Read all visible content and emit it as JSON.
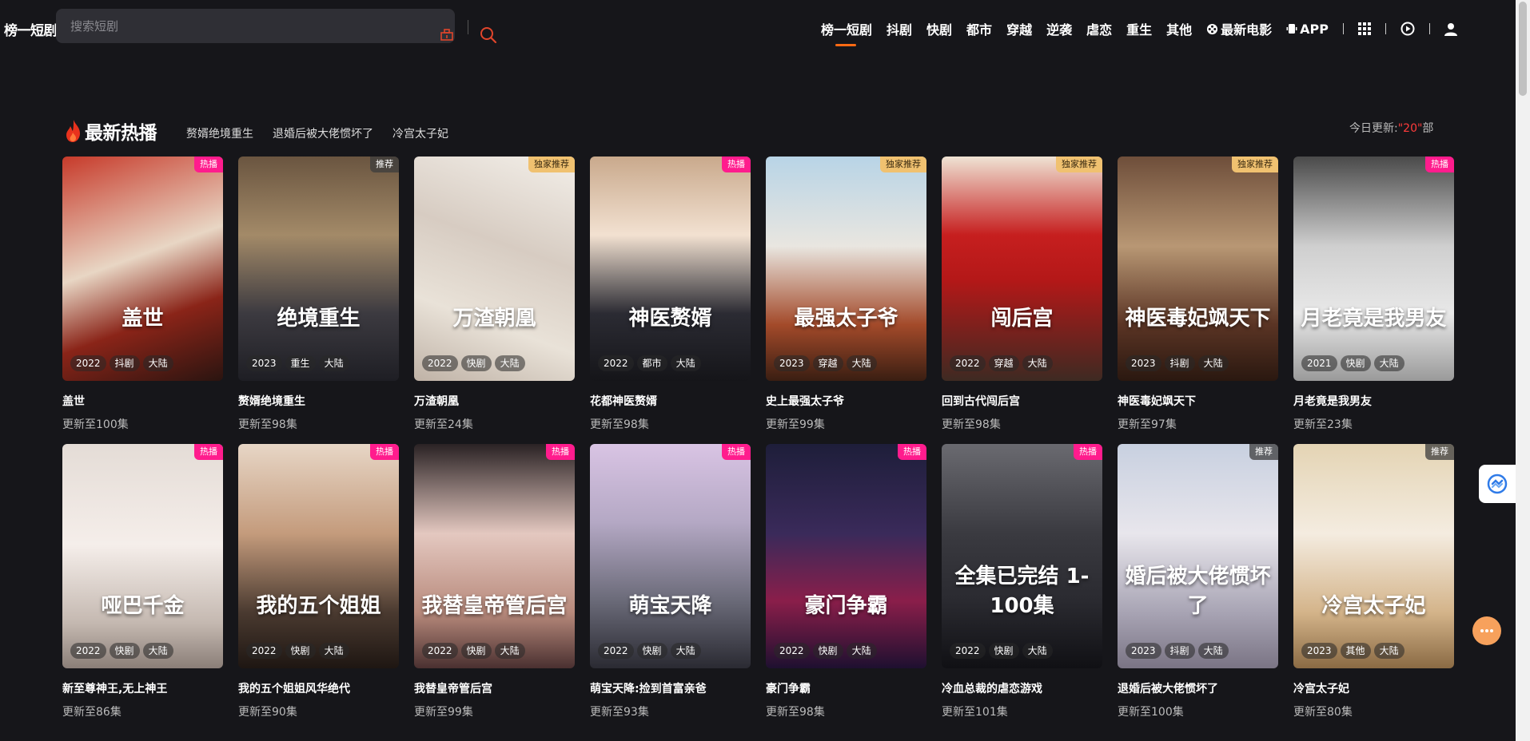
{
  "header": {
    "logo": "榜一短剧",
    "search_placeholder": "搜索短剧",
    "nav": [
      {
        "label": "榜一短剧",
        "active": true
      },
      {
        "label": "抖剧"
      },
      {
        "label": "快剧"
      },
      {
        "label": "都市"
      },
      {
        "label": "穿越"
      },
      {
        "label": "逆袭"
      },
      {
        "label": "虐恋"
      },
      {
        "label": "重生"
      },
      {
        "label": "其他"
      }
    ],
    "movie_label": "最新电影",
    "app_label": "APP"
  },
  "section": {
    "title": "最新热播",
    "quick_links": [
      "赘婿绝境重生",
      "退婚后被大佬惯坏了",
      "冷宫太子妃"
    ],
    "today_prefix": "今日更新:",
    "today_count": "\"20\"",
    "today_suffix": "部"
  },
  "colors": {
    "accent": "#ff6a13",
    "hot_badge": "#ff1c8d",
    "exclusive_badge": "#f0c170",
    "background": "#16161a"
  },
  "cards": [
    {
      "title": "盖世",
      "update": "更新至100集",
      "badge": "热播",
      "badge_type": "hot",
      "year": "2022",
      "platform": "抖剧",
      "region": "大陆",
      "poster_text": "盖世",
      "bg": "linear-gradient(160deg,#c73a2a 0%,#e8d6c4 45%,#8a2418 70%,#2a1410 100%)"
    },
    {
      "title": "赘婿绝境重生",
      "update": "更新至98集",
      "badge": "推荐",
      "badge_type": "rec",
      "year": "2023",
      "platform": "重生",
      "region": "大陆",
      "poster_text": "绝境重生",
      "bg": "linear-gradient(180deg,#6a5540 0%,#a38a68 35%,#3c3a40 70%,#1e1e24 100%)"
    },
    {
      "title": "万渣朝凰",
      "update": "更新至24集",
      "badge": "独家推荐",
      "badge_type": "exclusive",
      "year": "2022",
      "platform": "快剧",
      "region": "大陆",
      "poster_text": "万渣朝凰",
      "bg": "linear-gradient(200deg,#f3efe9 0%,#d7ccc2 40%,#e9e2d8 70%,#bfb2a6 100%)"
    },
    {
      "title": "花都神医赘婿",
      "update": "更新至98集",
      "badge": "热播",
      "badge_type": "hot",
      "year": "2022",
      "platform": "都市",
      "region": "大陆",
      "poster_text": "神医赘婿",
      "bg": "linear-gradient(180deg,#c9a98c 0%,#f2e1d1 35%,#2b2b33 70%,#151519 100%)"
    },
    {
      "title": "史上最强太子爷",
      "update": "更新至99集",
      "badge": "独家推荐",
      "badge_type": "exclusive",
      "year": "2023",
      "platform": "穿越",
      "region": "大陆",
      "poster_text": "最强太子爷",
      "bg": "linear-gradient(180deg,#b8d4e6 0%,#e9e6e0 40%,#a34a2a 75%,#3a1e12 100%)"
    },
    {
      "title": "回到古代闯后宫",
      "update": "更新至98集",
      "badge": "独家推荐",
      "badge_type": "exclusive",
      "year": "2022",
      "platform": "穿越",
      "region": "大陆",
      "poster_text": "闯后宫",
      "bg": "linear-gradient(180deg,#efe3d4 0%,#c61f1f 35%,#b41818 55%,#3e2a22 100%)"
    },
    {
      "title": "神医毒妃飒天下",
      "update": "更新至97集",
      "badge": "独家推荐",
      "badge_type": "exclusive",
      "year": "2023",
      "platform": "抖剧",
      "region": "大陆",
      "poster_text": "神医毒妃飒天下",
      "bg": "linear-gradient(180deg,#6e4e3a 0%,#b89774 40%,#5a3424 75%,#2a1810 100%)"
    },
    {
      "title": "月老竟是我男友",
      "update": "更新至23集",
      "badge": "热播",
      "badge_type": "hot",
      "year": "2021",
      "platform": "快剧",
      "region": "大陆",
      "poster_text": "月老竟是我男友",
      "bg": "linear-gradient(180deg,#4a4a4a 0%,#cfcfcf 40%,#e8e8e8 70%,#9a9a9a 100%)"
    },
    {
      "title": "新至尊神王,无上神王",
      "update": "更新至86集",
      "badge": "热播",
      "badge_type": "hot",
      "year": "2022",
      "platform": "快剧",
      "region": "大陆",
      "poster_text": "哑巴千金",
      "bg": "linear-gradient(180deg,#e4dcd6 0%,#f5eeea 45%,#c4b8b0 80%,#8a7e78 100%)"
    },
    {
      "title": "我的五个姐姐风华绝代",
      "update": "更新至90集",
      "badge": "热播",
      "badge_type": "hot",
      "year": "2022",
      "platform": "快剧",
      "region": "大陆",
      "poster_text": "我的五个姐姐",
      "bg": "linear-gradient(180deg,#e7d6c6 0%,#c49b7c 40%,#4a3a30 75%,#1e1612 100%)"
    },
    {
      "title": "我替皇帝管后宫",
      "update": "更新至99集",
      "badge": "热播",
      "badge_type": "hot",
      "year": "2022",
      "platform": "快剧",
      "region": "大陆",
      "poster_text": "我替皇帝管后宫",
      "bg": "linear-gradient(180deg,#2a2224 0%,#e4c8c0 40%,#b88a7c 75%,#4a3030 100%)"
    },
    {
      "title": "萌宝天降:捡到首富亲爸",
      "update": "更新至93集",
      "badge": "热播",
      "badge_type": "hot",
      "year": "2022",
      "platform": "快剧",
      "region": "大陆",
      "poster_text": "萌宝天降",
      "bg": "linear-gradient(180deg,#d9c4e4 0%,#b4a8c4 35%,#6a6a78 70%,#2a2a32 100%)"
    },
    {
      "title": "豪门争霸",
      "update": "更新至98集",
      "badge": "热播",
      "badge_type": "hot",
      "year": "2022",
      "platform": "快剧",
      "region": "大陆",
      "poster_text": "豪门争霸",
      "bg": "linear-gradient(180deg,#1e1e3a 0%,#3a2a5a 40%,#8a1e4a 70%,#1e1030 100%)"
    },
    {
      "title": "冷血总裁的虐恋游戏",
      "update": "更新至101集",
      "badge": "热播",
      "badge_type": "hot",
      "year": "2022",
      "platform": "快剧",
      "region": "大陆",
      "poster_text": "全集已完结 1-100集",
      "bg": "linear-gradient(180deg,#6a6a70 0%,#3a3a40 40%,#2a2a30 70%,#101014 100%)"
    },
    {
      "title": "退婚后被大佬惯坏了",
      "update": "更新至100集",
      "badge": "推荐",
      "badge_type": "rec",
      "year": "2023",
      "platform": "抖剧",
      "region": "大陆",
      "poster_text": "婚后被大佬惯坏了",
      "bg": "linear-gradient(180deg,#c8d0e0 0%,#e8e6ec 40%,#a8a4b4 75%,#7a7484 100%)"
    },
    {
      "title": "冷宫太子妃",
      "update": "更新至80集",
      "badge": "推荐",
      "badge_type": "rec",
      "year": "2023",
      "platform": "其他",
      "region": "大陆",
      "poster_text": "冷宫太子妃",
      "bg": "linear-gradient(180deg,#e4d4b4 0%,#f4ece0 40%,#d4b48a 75%,#8a6a44 100%)"
    }
  ]
}
